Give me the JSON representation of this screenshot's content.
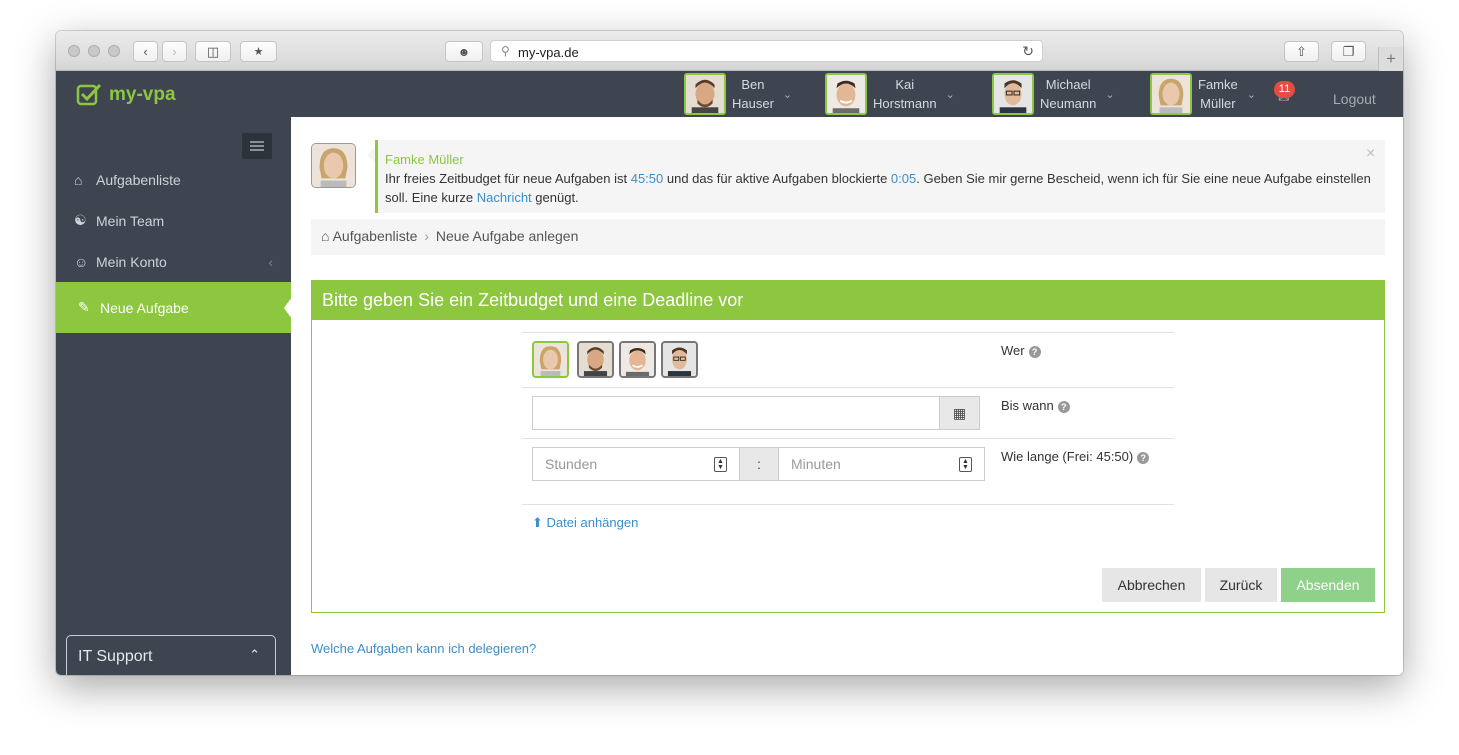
{
  "browser": {
    "url": "my-vpa.de"
  },
  "app": {
    "logo_text": "my-vpa"
  },
  "topbar": {
    "users": [
      {
        "first": "Ben",
        "last": "Hauser"
      },
      {
        "first": "Kai",
        "last": "Horstmann"
      },
      {
        "first": "Michael",
        "last": "Neumann"
      },
      {
        "first": "Famke",
        "last": "Müller"
      }
    ],
    "notification_count": "11",
    "logout_label": "Logout"
  },
  "sidebar": {
    "items": [
      {
        "label": "Aufgabenliste"
      },
      {
        "label": "Mein Team"
      },
      {
        "label": "Mein Konto"
      },
      {
        "label": "Neue Aufgabe"
      }
    ],
    "support_label": "IT Support"
  },
  "notice": {
    "name": "Famke Müller",
    "text1": "Ihr freies Zeitbudget für neue Aufgaben ist ",
    "budget": "45:50",
    "text2": " und das für aktive Aufgaben blockierte ",
    "blocked": "0:05",
    "text3": ". Geben Sie mir gerne Bescheid, wenn ich für Sie eine neue Aufgabe einstellen soll. Eine kurze ",
    "link": "Nachricht",
    "text4": " genügt."
  },
  "breadcrumb": {
    "home": "Aufgabenliste",
    "current": "Neue Aufgabe anlegen"
  },
  "form": {
    "title": "Bitte geben Sie ein Zeitbudget und eine Deadline vor",
    "who_label": "Wer",
    "until_label": "Bis wann",
    "duration_label": "Wie lange (Frei: 45:50)",
    "hours_placeholder": "Stunden",
    "minutes_placeholder": "Minuten",
    "separator": ":",
    "attach_label": "Datei anhängen",
    "cancel_label": "Abbrechen",
    "back_label": "Zurück",
    "submit_label": "Absenden"
  },
  "help_link": "Welche Aufgaben kann ich delegieren?",
  "colors": {
    "accent": "#8dc63f",
    "dark": "#3e4550",
    "link": "#3b8fca"
  }
}
